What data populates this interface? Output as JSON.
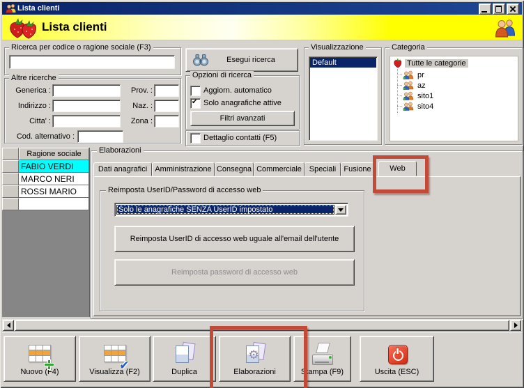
{
  "window": {
    "title": "Lista clienti"
  },
  "header": {
    "title": "Lista clienti"
  },
  "search": {
    "group_label": "Ricerca per codice o ragione sociale (F3)",
    "value": ""
  },
  "altre": {
    "label": "Altre ricerche",
    "generica": "Generica :",
    "indirizzo": "Indirizzo :",
    "citta": "Citta' :",
    "cod_alt": "Cod. alternativo :",
    "prov": "Prov. :",
    "naz": "Naz. :",
    "zona": "Zona :"
  },
  "ricerca": {
    "esegui": "Esegui ricerca",
    "opzioni_label": "Opzioni di ricerca",
    "aggiorn": "Aggiorn. automatico",
    "solo_attive": "Solo anagrafiche attive",
    "filtri": "Filtri avanzati",
    "dettaglio": "Dettaglio contatti (F5)"
  },
  "visualizzazione": {
    "label": "Visualizzazione",
    "items": [
      "Default"
    ],
    "selected": "Default"
  },
  "categoria": {
    "label": "Categoria",
    "root": "Tutte le categorie",
    "items": [
      "pr",
      "az",
      "sito1",
      "sito4"
    ]
  },
  "clienti": {
    "col_ragione_sociale": "Ragione sociale",
    "rows": [
      "FABIO VERDI",
      "MARCO NERI",
      "ROSSI MARIO"
    ],
    "selected_row": "FABIO VERDI"
  },
  "elaborazioni": {
    "label": "Elaborazioni",
    "tabs": [
      "Dati anagrafici",
      "Amministrazione",
      "Consegna",
      "Commerciale",
      "Speciali",
      "Fusione",
      "Web"
    ],
    "active_tab": "Web",
    "reimposta": {
      "group_label": "Reimposta UserID/Password di accesso web",
      "combo_value": "Solo le anagrafiche SENZA UserID impostato",
      "btn_userid": "Reimposta UserID di accesso web uguale all'email dell'utente",
      "btn_password": "Reimposta password di accesso web",
      "btn_password_enabled": false
    }
  },
  "toolbar": {
    "buttons": [
      "Nuovo (F4)",
      "Visualizza (F2)",
      "Duplica",
      "Elaborazioni",
      "Stampa (F9)",
      "Uscita (ESC)"
    ]
  },
  "annotations": {
    "color": "#c14b38",
    "targets": [
      "Web tab",
      "Elaborazioni toolbar button"
    ]
  },
  "colors": {
    "titlebar": "#0a246a",
    "header_yellow": "#ffff00",
    "row_selected": "#00ffff",
    "combo_selected": "#0a246a",
    "annotation": "#c14b38"
  }
}
